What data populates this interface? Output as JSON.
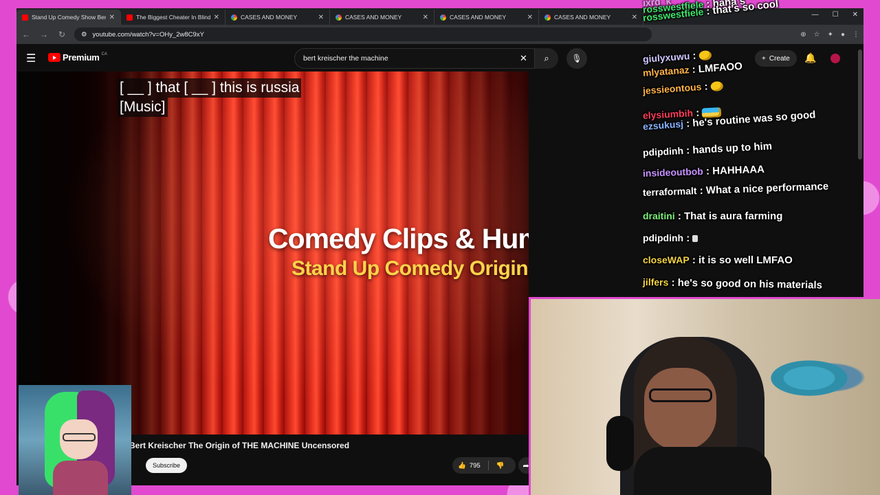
{
  "tabs": [
    {
      "label": "Stand Up Comedy Show Bert Kr",
      "favicon": "youtube-icon",
      "active": true
    },
    {
      "label": "The Biggest Cheater In Blindfold",
      "favicon": "youtube-icon",
      "active": false
    },
    {
      "label": "CASES AND MONEY",
      "favicon": "google-icon",
      "active": false
    },
    {
      "label": "CASES AND MONEY",
      "favicon": "google-icon",
      "active": false
    },
    {
      "label": "CASES AND MONEY",
      "favicon": "google-icon",
      "active": false
    },
    {
      "label": "CASES AND MONEY",
      "favicon": "google-icon",
      "active": false
    }
  ],
  "address_bar": {
    "url": "youtube.com/watch?v=OHy_2w8C9xY"
  },
  "youtube": {
    "brand": "Premium",
    "country": "CA",
    "search_value": "bert kreischer the machine",
    "create_label": "Create"
  },
  "video": {
    "caption_line1": "[ __ ] that [ __ ] this is russia",
    "caption_line2": "[Music]",
    "overlay_title": "Comedy Clips & Humor",
    "overlay_subtitle": "Stand Up Comedy Originals",
    "title": "Bert Kreischer The Origin of THE MACHINE Uncensored",
    "subscribe_label": "Subscribe",
    "like_count": "795"
  },
  "chat": [
    {
      "user": "ixrd_k",
      "message": "",
      "color": "#e8e8ff",
      "emote": ""
    },
    {
      "user": "rosswestfiele",
      "message": "haha s",
      "color": "#3ee86c",
      "emote": ""
    },
    {
      "user": "rosswestfiele",
      "message": "that's so cool",
      "color": "#3ee86c",
      "emote": ""
    },
    {
      "user": "giulyxuwu",
      "message": "",
      "color": "#cfc8ff",
      "emote": "laugh-emote"
    },
    {
      "user": "mlyatanaz",
      "message": "LMFAOO",
      "color": "#ffb347",
      "emote": ""
    },
    {
      "user": "jessieontous",
      "message": "",
      "color": "#ffb347",
      "emote": "laugh-emote"
    },
    {
      "user": "elysiumbih",
      "message": "",
      "color": "#ff3c5a",
      "emote": "car-emote"
    },
    {
      "user": "ezsukusj",
      "message": "he's routine was so good",
      "color": "#8ab4ff",
      "emote": ""
    },
    {
      "user": "pdipdinh",
      "message": "hands up to him",
      "color": "#ffffff",
      "emote": ""
    },
    {
      "user": "insideoutbob",
      "message": "HAHHAAA",
      "color": "#c792ff",
      "emote": ""
    },
    {
      "user": "terraformalt",
      "message": "What a nice performance",
      "color": "#ffffff",
      "emote": ""
    },
    {
      "user": "draitini",
      "message": "That is aura farming",
      "color": "#7cf07c",
      "emote": ""
    },
    {
      "user": "pdipdinh",
      "message": "",
      "color": "#ffffff",
      "emote": "small-emote"
    },
    {
      "user": "closeWAP",
      "message": "it is so well LMFAO",
      "color": "#f5d442",
      "emote": ""
    },
    {
      "user": "jilfers",
      "message": "he's so good on his materials",
      "color": "#f5d442",
      "emote": ""
    }
  ],
  "colors": {
    "frame": "#e14ad0",
    "youtube_red": "#ff0000",
    "caption_yellow": "#ffd44a"
  }
}
